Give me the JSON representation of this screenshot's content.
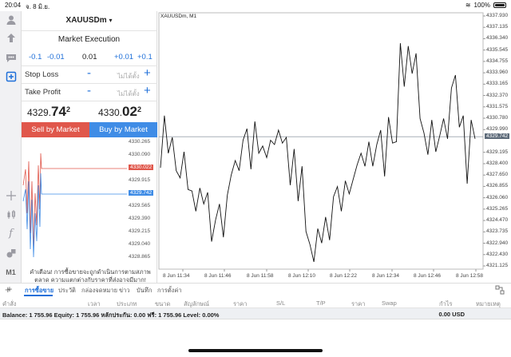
{
  "status_bar": {
    "time": "20:04",
    "date": "จ. 8 มิ.ย.",
    "battery": "100%"
  },
  "toolbar": {
    "icons": [
      "user-icon",
      "trade-icon",
      "chat-icon",
      "new-order-icon"
    ],
    "tools": [
      "crosshair-icon",
      "candles-icon",
      "function-icon",
      "objects-icon"
    ],
    "timeframe": "M1",
    "add": "+"
  },
  "order": {
    "symbol": "XAUUSDm",
    "symbol_arrow": "▾",
    "execution": "Market Execution",
    "volume_steps": [
      "-0.1",
      "-0.01",
      "0.01",
      "+0.01",
      "+0.1"
    ],
    "stop_loss_label": "Stop Loss",
    "take_profit_label": "Take Profit",
    "not_set": "ไม่ได้ตั้ง",
    "minus": "-",
    "plus": "+",
    "bid_prefix": "4329.",
    "bid_big": "74",
    "bid_sup": "2",
    "ask_prefix": "4330.",
    "ask_big": "02",
    "ask_sup": "2",
    "sell_label": "Sell by Market",
    "buy_label": "Buy by Market",
    "warning": "คำเตือน! การซื้อขายจะถูกดำเนินการตามสภาพตลาด ความแตกต่างกับราคาที่ส่งอาจมีมาก!",
    "mini_levels": [
      "4330.265",
      "4330.090",
      "4330.022",
      "4329.915",
      "4329.742",
      "4329.565",
      "4329.390",
      "4329.215",
      "4329.040",
      "4328.865"
    ],
    "ask_color": "#e0574b",
    "bid_color": "#3f8ce6"
  },
  "chart_data": {
    "type": "line",
    "title": "XAUUSDm, M1",
    "x_labels": [
      "8 Jun 11:34",
      "8 Jun 11:46",
      "8 Jun 11:58",
      "8 Jun 12:10",
      "8 Jun 12:22",
      "8 Jun 12:34",
      "8 Jun 12:46",
      "8 Jun 12:58"
    ],
    "y_labels": [
      "4337.930",
      "4337.135",
      "4336.340",
      "4335.545",
      "4334.755",
      "4333.960",
      "4333.165",
      "4332.370",
      "4331.575",
      "4330.780",
      "4329.990",
      "4329.742",
      "4329.195",
      "4328.400",
      "4327.650",
      "4326.855",
      "4326.060",
      "4325.265",
      "4324.470",
      "4323.735",
      "4322.940",
      "4322.430",
      "4321.125"
    ],
    "current_price": "4329.742",
    "ylim": [
      4320.6,
      4338.3
    ],
    "values": [
      4327.6,
      4331.2,
      4328.6,
      4329.7,
      4327.4,
      4326.9,
      4328.7,
      4326.1,
      4326.0,
      4324.6,
      4326.2,
      4325.1,
      4325.9,
      4322.5,
      4324.0,
      4325.1,
      4322.8,
      4325.7,
      4327.1,
      4328.1,
      4327.4,
      4329.5,
      4330.3,
      4327.5,
      4330.8,
      4328.6,
      4329.1,
      4328.3,
      4329.5,
      4329.2,
      4330.2,
      4329.3,
      4329.7,
      4326.4,
      4328.9,
      4325.3,
      4327.7,
      4323.2,
      4322.3,
      4321.1,
      4323.4,
      4322.4,
      4324.2,
      4322.6,
      4325.6,
      4326.3,
      4324.6,
      4326.7,
      4325.8,
      4326.8,
      4327.8,
      4328.6,
      4327.7,
      4329.4,
      4327.7,
      4329.2,
      4330.2,
      4327.0,
      4331.1,
      4329.3,
      4329.4,
      4336.2,
      4333.2,
      4336.0,
      4334.1,
      4335.5,
      4331.0,
      4330.0,
      4328.5,
      4330.9,
      4328.7,
      4329.8,
      4331.0,
      4329.6,
      4333.1,
      4334.0,
      4330.4,
      4331.2,
      4326.5,
      4330.9,
      4329.6
    ]
  },
  "tabs": [
    "การซื้อขาย",
    "ประวัติ",
    "กล่องจดหมาย",
    "ข่าว",
    "บันทึก",
    "การตั้งค่า"
  ],
  "columns": [
    "คำสั่ง",
    "เวลา",
    "ประเภท",
    "ขนาด",
    "สัญลักษณ์",
    "ราคา",
    "S/L",
    "T/P",
    "ราคา",
    "Swap",
    "กำไร",
    "หมายเหตุ"
  ],
  "balance_line": "Balance: 1 755.96 Equity: 1 755.96 หลักประกัน: 0.00 ฟรี: 1 755.96 Level: 0.00%",
  "balance_profit": "0.00  USD"
}
